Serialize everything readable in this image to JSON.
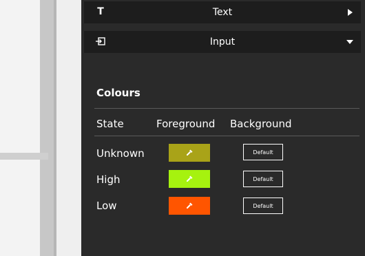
{
  "sections": {
    "text": {
      "label": "Text",
      "icon": "text-type-icon",
      "icon_glyph": "T",
      "state": "collapsed"
    },
    "input": {
      "label": "Input",
      "icon": "input-icon",
      "state": "expanded"
    }
  },
  "colours": {
    "title": "Colours",
    "columns": {
      "state": "State",
      "foreground": "Foreground",
      "background": "Background"
    },
    "rows": [
      {
        "state": "Unknown",
        "foreground_color": "#a9a318",
        "background_label": "Default"
      },
      {
        "state": "High",
        "foreground_color": "#a6f20f",
        "background_label": "Default"
      },
      {
        "state": "Low",
        "foreground_color": "#ff5500",
        "background_label": "Default"
      }
    ]
  }
}
